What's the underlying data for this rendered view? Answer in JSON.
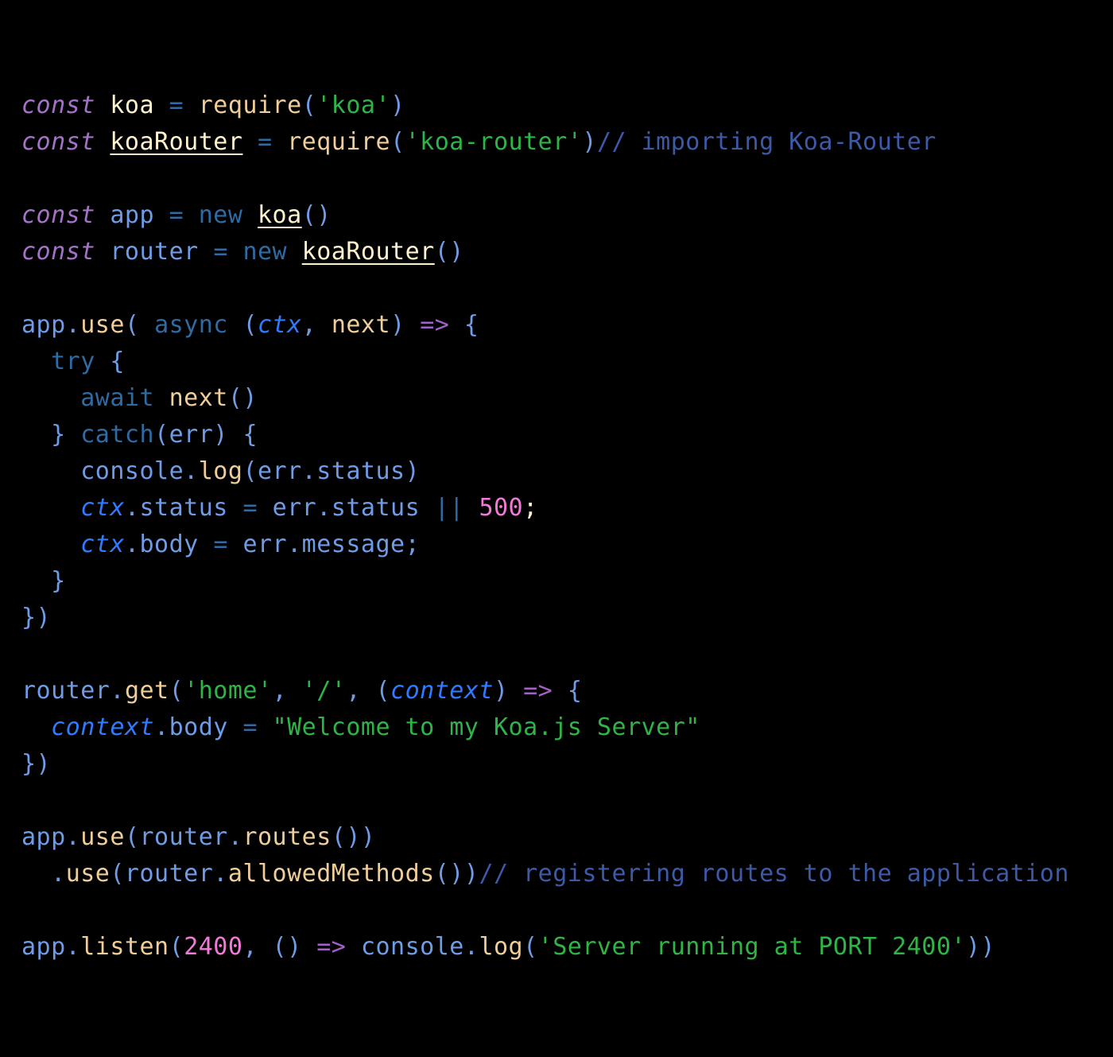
{
  "editor": {
    "language": "javascript",
    "colors": {
      "background": "#000000",
      "keyword": "#a572c9",
      "control_keyword": "#2f6aa3",
      "variable": "#fff3cc",
      "function": "#f0cd99",
      "string": "#2fb446",
      "comment": "#3d5aa8",
      "punctuation": "#6f9ce6",
      "parameter": "#2f7bff",
      "number": "#f07ad6",
      "arrow": "#a461c7"
    },
    "lines": [
      [
        {
          "t": "const",
          "c": "kw"
        },
        {
          "t": " "
        },
        {
          "t": "koa",
          "c": "var"
        },
        {
          "t": " "
        },
        {
          "t": "=",
          "c": "op"
        },
        {
          "t": " "
        },
        {
          "t": "require",
          "c": "fn"
        },
        {
          "t": "(",
          "c": "p"
        },
        {
          "t": "'koa'",
          "c": "str"
        },
        {
          "t": ")",
          "c": "p"
        }
      ],
      [
        {
          "t": "const",
          "c": "kw"
        },
        {
          "t": " "
        },
        {
          "t": "koaRouter",
          "c": "var u"
        },
        {
          "t": " "
        },
        {
          "t": "=",
          "c": "op"
        },
        {
          "t": " "
        },
        {
          "t": "require",
          "c": "fn"
        },
        {
          "t": "(",
          "c": "p"
        },
        {
          "t": "'koa-router'",
          "c": "str"
        },
        {
          "t": ")",
          "c": "p"
        },
        {
          "t": "// importing Koa-Router",
          "c": "cm"
        }
      ],
      [],
      [
        {
          "t": "const",
          "c": "kw"
        },
        {
          "t": " "
        },
        {
          "t": "app",
          "c": "p"
        },
        {
          "t": " "
        },
        {
          "t": "=",
          "c": "op"
        },
        {
          "t": " "
        },
        {
          "t": "new",
          "c": "kw2"
        },
        {
          "t": " "
        },
        {
          "t": "koa",
          "c": "var u"
        },
        {
          "t": "()",
          "c": "p"
        }
      ],
      [
        {
          "t": "const",
          "c": "kw"
        },
        {
          "t": " "
        },
        {
          "t": "router",
          "c": "p"
        },
        {
          "t": " "
        },
        {
          "t": "=",
          "c": "op"
        },
        {
          "t": " "
        },
        {
          "t": "new",
          "c": "kw2"
        },
        {
          "t": " "
        },
        {
          "t": "koaRouter",
          "c": "var u"
        },
        {
          "t": "()",
          "c": "p"
        }
      ],
      [],
      [
        {
          "t": "app",
          "c": "p"
        },
        {
          "t": ".",
          "c": "p"
        },
        {
          "t": "use",
          "c": "fn"
        },
        {
          "t": "( ",
          "c": "p"
        },
        {
          "t": "async",
          "c": "kw2"
        },
        {
          "t": " "
        },
        {
          "t": "(",
          "c": "p"
        },
        {
          "t": "ctx",
          "c": "param"
        },
        {
          "t": ", ",
          "c": "p"
        },
        {
          "t": "next",
          "c": "fn"
        },
        {
          "t": ")",
          "c": "p"
        },
        {
          "t": " "
        },
        {
          "t": "=>",
          "c": "arrow"
        },
        {
          "t": " "
        },
        {
          "t": "{",
          "c": "p"
        }
      ],
      [
        {
          "t": "  "
        },
        {
          "t": "try",
          "c": "kw2"
        },
        {
          "t": " "
        },
        {
          "t": "{",
          "c": "p"
        }
      ],
      [
        {
          "t": "    "
        },
        {
          "t": "await",
          "c": "kw2"
        },
        {
          "t": " "
        },
        {
          "t": "next",
          "c": "fn"
        },
        {
          "t": "()",
          "c": "p"
        }
      ],
      [
        {
          "t": "  "
        },
        {
          "t": "}",
          "c": "p"
        },
        {
          "t": " "
        },
        {
          "t": "catch",
          "c": "kw2"
        },
        {
          "t": "(err)",
          "c": "p"
        },
        {
          "t": " "
        },
        {
          "t": "{",
          "c": "p"
        }
      ],
      [
        {
          "t": "    "
        },
        {
          "t": "console.",
          "c": "p"
        },
        {
          "t": "log",
          "c": "fn"
        },
        {
          "t": "(err.status)",
          "c": "p"
        }
      ],
      [
        {
          "t": "    "
        },
        {
          "t": "ctx",
          "c": "param"
        },
        {
          "t": ".status",
          "c": "p"
        },
        {
          "t": " "
        },
        {
          "t": "=",
          "c": "op"
        },
        {
          "t": " "
        },
        {
          "t": "err.status",
          "c": "p"
        },
        {
          "t": " "
        },
        {
          "t": "||",
          "c": "op"
        },
        {
          "t": " "
        },
        {
          "t": "500",
          "c": "num"
        },
        {
          "t": ";",
          "c": "var"
        }
      ],
      [
        {
          "t": "    "
        },
        {
          "t": "ctx",
          "c": "param"
        },
        {
          "t": ".body",
          "c": "p"
        },
        {
          "t": " "
        },
        {
          "t": "=",
          "c": "op"
        },
        {
          "t": " "
        },
        {
          "t": "err.message;",
          "c": "p"
        }
      ],
      [
        {
          "t": "  "
        },
        {
          "t": "}",
          "c": "p"
        }
      ],
      [
        {
          "t": "})",
          "c": "p"
        }
      ],
      [],
      [
        {
          "t": "router.",
          "c": "p"
        },
        {
          "t": "get",
          "c": "fn"
        },
        {
          "t": "(",
          "c": "p"
        },
        {
          "t": "'home'",
          "c": "str"
        },
        {
          "t": ", ",
          "c": "p"
        },
        {
          "t": "'/'",
          "c": "str"
        },
        {
          "t": ", ",
          "c": "p"
        },
        {
          "t": "(",
          "c": "p"
        },
        {
          "t": "context",
          "c": "param"
        },
        {
          "t": ")",
          "c": "p"
        },
        {
          "t": " "
        },
        {
          "t": "=>",
          "c": "arrow"
        },
        {
          "t": " "
        },
        {
          "t": "{",
          "c": "p"
        }
      ],
      [
        {
          "t": "  "
        },
        {
          "t": "context",
          "c": "param"
        },
        {
          "t": ".body",
          "c": "p"
        },
        {
          "t": " "
        },
        {
          "t": "=",
          "c": "op"
        },
        {
          "t": " "
        },
        {
          "t": "\"Welcome to my Koa.js Server\"",
          "c": "str"
        }
      ],
      [
        {
          "t": "})",
          "c": "p"
        }
      ],
      [],
      [
        {
          "t": "app.",
          "c": "p"
        },
        {
          "t": "use",
          "c": "fn"
        },
        {
          "t": "(router.",
          "c": "p"
        },
        {
          "t": "routes",
          "c": "fn"
        },
        {
          "t": "())",
          "c": "p"
        }
      ],
      [
        {
          "t": "  "
        },
        {
          "t": ".",
          "c": "p"
        },
        {
          "t": "use",
          "c": "fn"
        },
        {
          "t": "(router.",
          "c": "p"
        },
        {
          "t": "allowedMethods",
          "c": "fn"
        },
        {
          "t": "())",
          "c": "p"
        },
        {
          "t": "// registering routes to the application",
          "c": "cm"
        }
      ],
      [],
      [
        {
          "t": "app.",
          "c": "p"
        },
        {
          "t": "listen",
          "c": "fn"
        },
        {
          "t": "(",
          "c": "p"
        },
        {
          "t": "2400",
          "c": "num"
        },
        {
          "t": ", ",
          "c": "p"
        },
        {
          "t": "()",
          "c": "p"
        },
        {
          "t": " "
        },
        {
          "t": "=>",
          "c": "arrow"
        },
        {
          "t": " "
        },
        {
          "t": "console.",
          "c": "p"
        },
        {
          "t": "log",
          "c": "fn"
        },
        {
          "t": "(",
          "c": "p"
        },
        {
          "t": "'Server running at PORT 2400'",
          "c": "str"
        },
        {
          "t": "))",
          "c": "p"
        }
      ]
    ]
  }
}
